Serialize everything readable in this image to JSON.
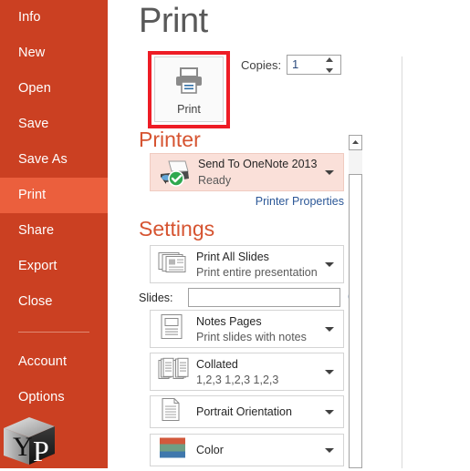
{
  "sidebar": {
    "items": [
      {
        "label": "Info",
        "active": false
      },
      {
        "label": "New",
        "active": false
      },
      {
        "label": "Open",
        "active": false
      },
      {
        "label": "Save",
        "active": false
      },
      {
        "label": "Save As",
        "active": false
      },
      {
        "label": "Print",
        "active": true
      },
      {
        "label": "Share",
        "active": false
      },
      {
        "label": "Export",
        "active": false
      },
      {
        "label": "Close",
        "active": false
      },
      {
        "label": "Account",
        "active": false
      },
      {
        "label": "Options",
        "active": false
      }
    ],
    "logo_letters": "YP",
    "background_color": "#cb4022",
    "active_color": "#eb5f3d"
  },
  "main": {
    "page_title": "Print",
    "print_button": {
      "label": "Print",
      "icon": "printer-icon",
      "highlight_color": "#ee1c25"
    },
    "copies": {
      "label": "Copies:",
      "value": "1"
    },
    "printer": {
      "heading": "Printer",
      "name": "Send To OneNote 2013",
      "status": "Ready",
      "icon": "printer-ready-icon",
      "properties_link": "Printer Properties"
    },
    "settings": {
      "heading": "Settings",
      "rows": [
        {
          "name": "print-range",
          "icon": "slides-stack-icon",
          "title": "Print All Slides",
          "subtitle": "Print entire presentation"
        },
        {
          "name": "print-layout",
          "icon": "notes-page-icon",
          "title": "Notes Pages",
          "subtitle": "Print slides with notes"
        },
        {
          "name": "collation",
          "icon": "collate-icon",
          "title": "Collated",
          "subtitle": "1,2,3   1,2,3   1,2,3"
        },
        {
          "name": "orientation",
          "icon": "portrait-page-icon",
          "title": "Portrait Orientation",
          "subtitle": ""
        },
        {
          "name": "color",
          "icon": "color-bars-icon",
          "title": "Color",
          "subtitle": ""
        }
      ],
      "slides_label": "Slides:",
      "slides_value": "",
      "slides_placeholder": "",
      "slides_info_icon": "info-icon"
    },
    "colors": {
      "accent_orange": "#d65431",
      "link_blue": "#2b5797",
      "color_bar_top": "#d2593c",
      "color_bar_mid": "#6f9e84",
      "color_bar_bottom": "#3f78ad"
    }
  },
  "scrollbar": {
    "up_arrow_icon": "scroll-up-arrow-icon",
    "thumb": "scroll-thumb"
  }
}
